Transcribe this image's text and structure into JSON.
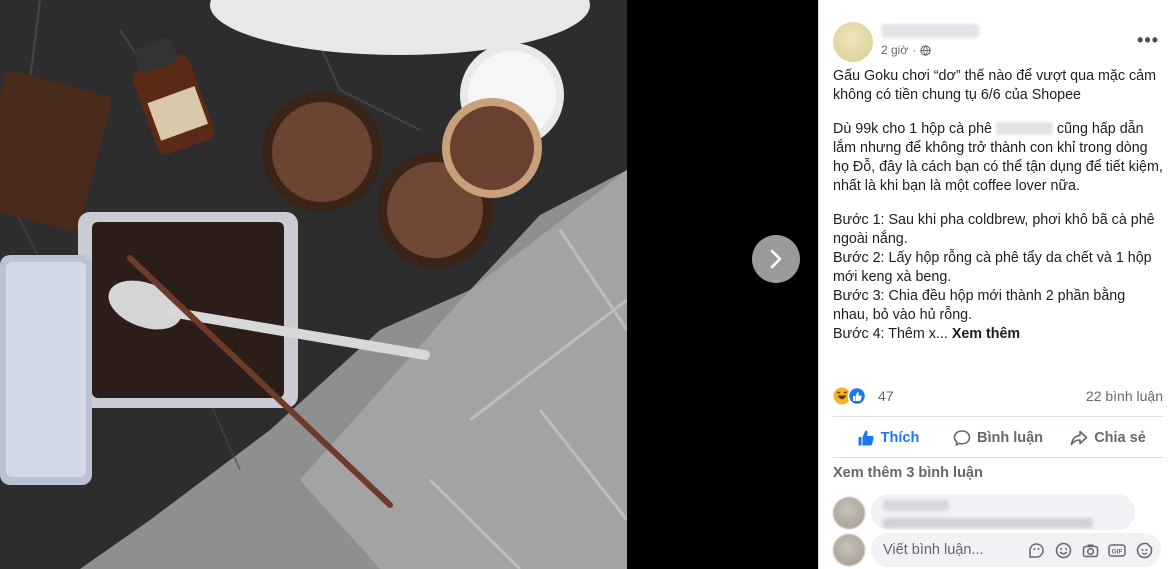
{
  "post": {
    "time": "2 giờ",
    "privacy_icon": "globe-icon",
    "title_line": "Gấu Goku chơi “dơ” thế nào để vượt qua mặc cảm không có tiền chung tụ 6/6 của Shopee",
    "para2_before": "Dù 99k cho 1 hộp cà phê ",
    "para2_after": " cũng hấp dẫn lắm nhưng để không trở thành con khỉ trong dòng họ Đỗ, đây là cách bạn có thể tận dụng để tiết kiệm, nhất là khi bạn là một coffee lover nữa.",
    "step1": "Bước 1: Sau khi pha coldbrew, phơi khô bã cà phê ngoài nắng.",
    "step2": "Bước 2: Lấy hộp rỗng cà phê tẩy da chết và 1 hộp mới keng xà beng.",
    "step3": "Bước 3: Chia đều hộp mới thành 2 phần bằng nhau, bỏ vào hủ rỗng.",
    "step4": "Bước 4: Thêm x...",
    "see_more": "Xem thêm"
  },
  "stats": {
    "reaction_icons": [
      "haha-icon",
      "like-icon"
    ],
    "reaction_count": "47",
    "comment_count": "22 bình luận"
  },
  "actions": {
    "like": "Thích",
    "comment": "Bình luận",
    "share": "Chia sẻ"
  },
  "comments": {
    "view_more": "Xem thêm 3 bình luận"
  },
  "composer": {
    "placeholder": "Viết bình luận...",
    "tools": [
      "sticker-icon",
      "emoji-icon",
      "camera-icon",
      "gif-icon",
      "avatar-sticker-icon"
    ]
  },
  "colors": {
    "accent": "#1877f2",
    "secondary_text": "#65676b",
    "primary_text": "#1c1e21"
  }
}
